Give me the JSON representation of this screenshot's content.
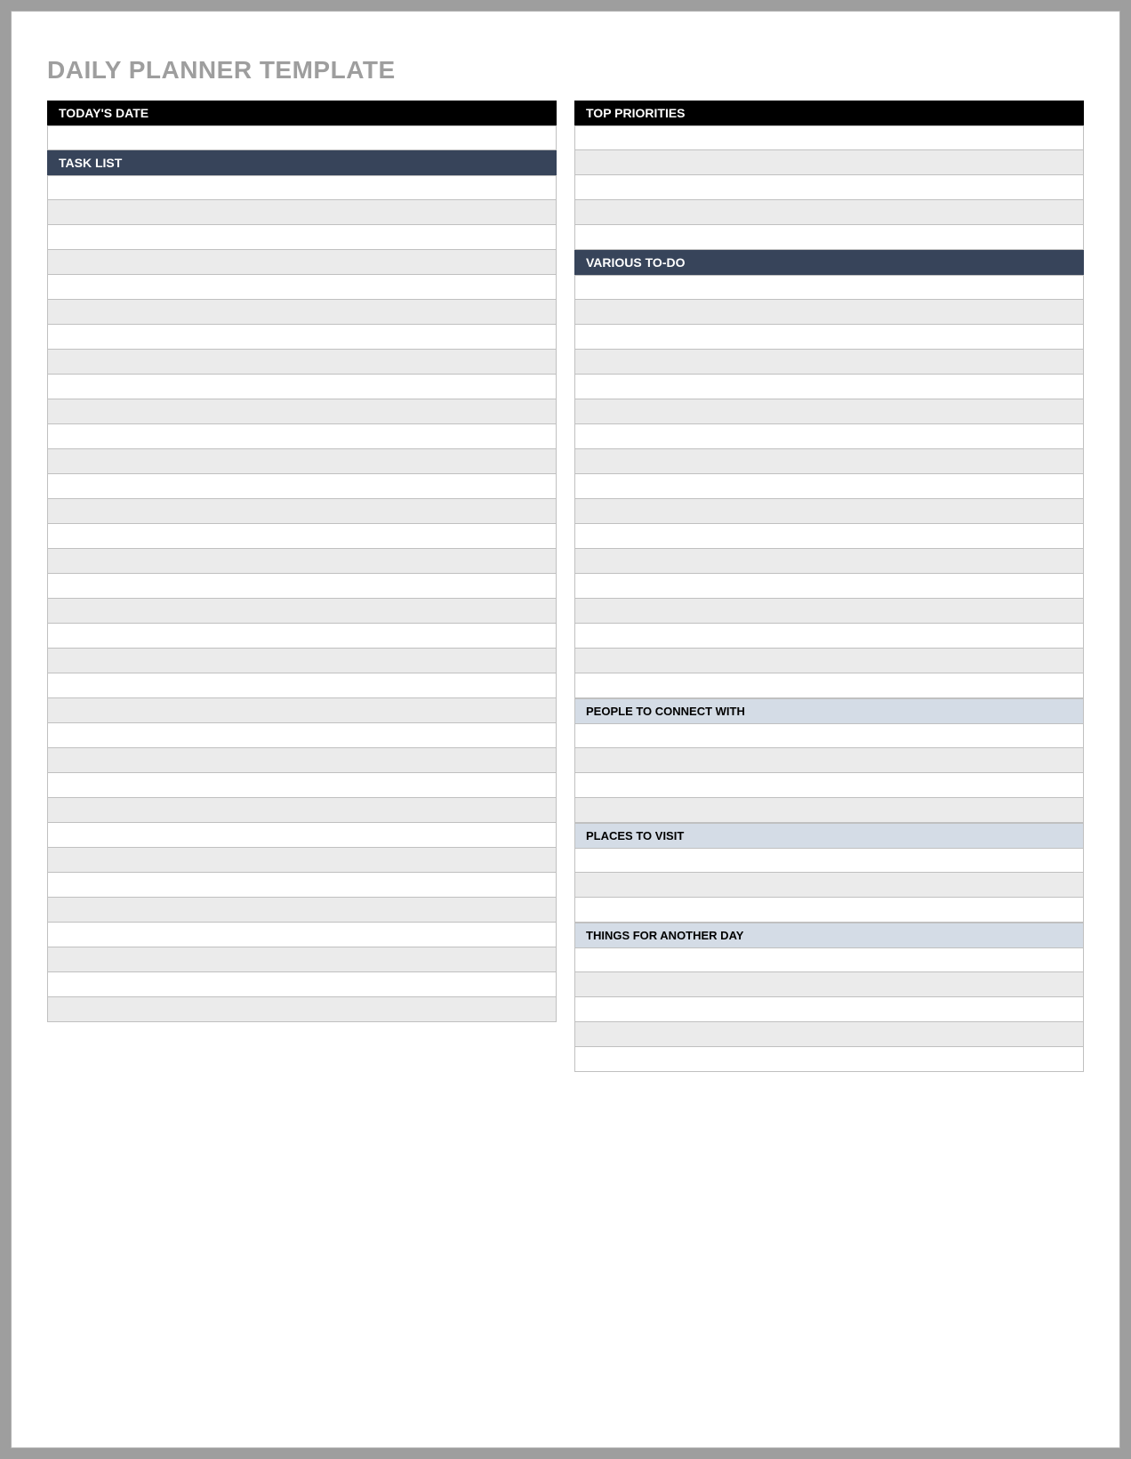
{
  "title": "DAILY PLANNER TEMPLATE",
  "left": {
    "todaysDate": {
      "label": "TODAY'S DATE",
      "rows": 1
    },
    "taskList": {
      "label": "TASK LIST",
      "rows": 34
    }
  },
  "right": {
    "topPriorities": {
      "label": "TOP PRIORITIES",
      "rows": 5
    },
    "variousTodo": {
      "label": "VARIOUS TO-DO",
      "rows": 17
    },
    "peopleToConnect": {
      "label": "PEOPLE TO CONNECT WITH",
      "rows": 4
    },
    "placesToVisit": {
      "label": "PLACES TO VISIT",
      "rows": 3
    },
    "thingsAnotherDay": {
      "label": "THINGS FOR ANOTHER DAY",
      "rows": 5
    }
  }
}
